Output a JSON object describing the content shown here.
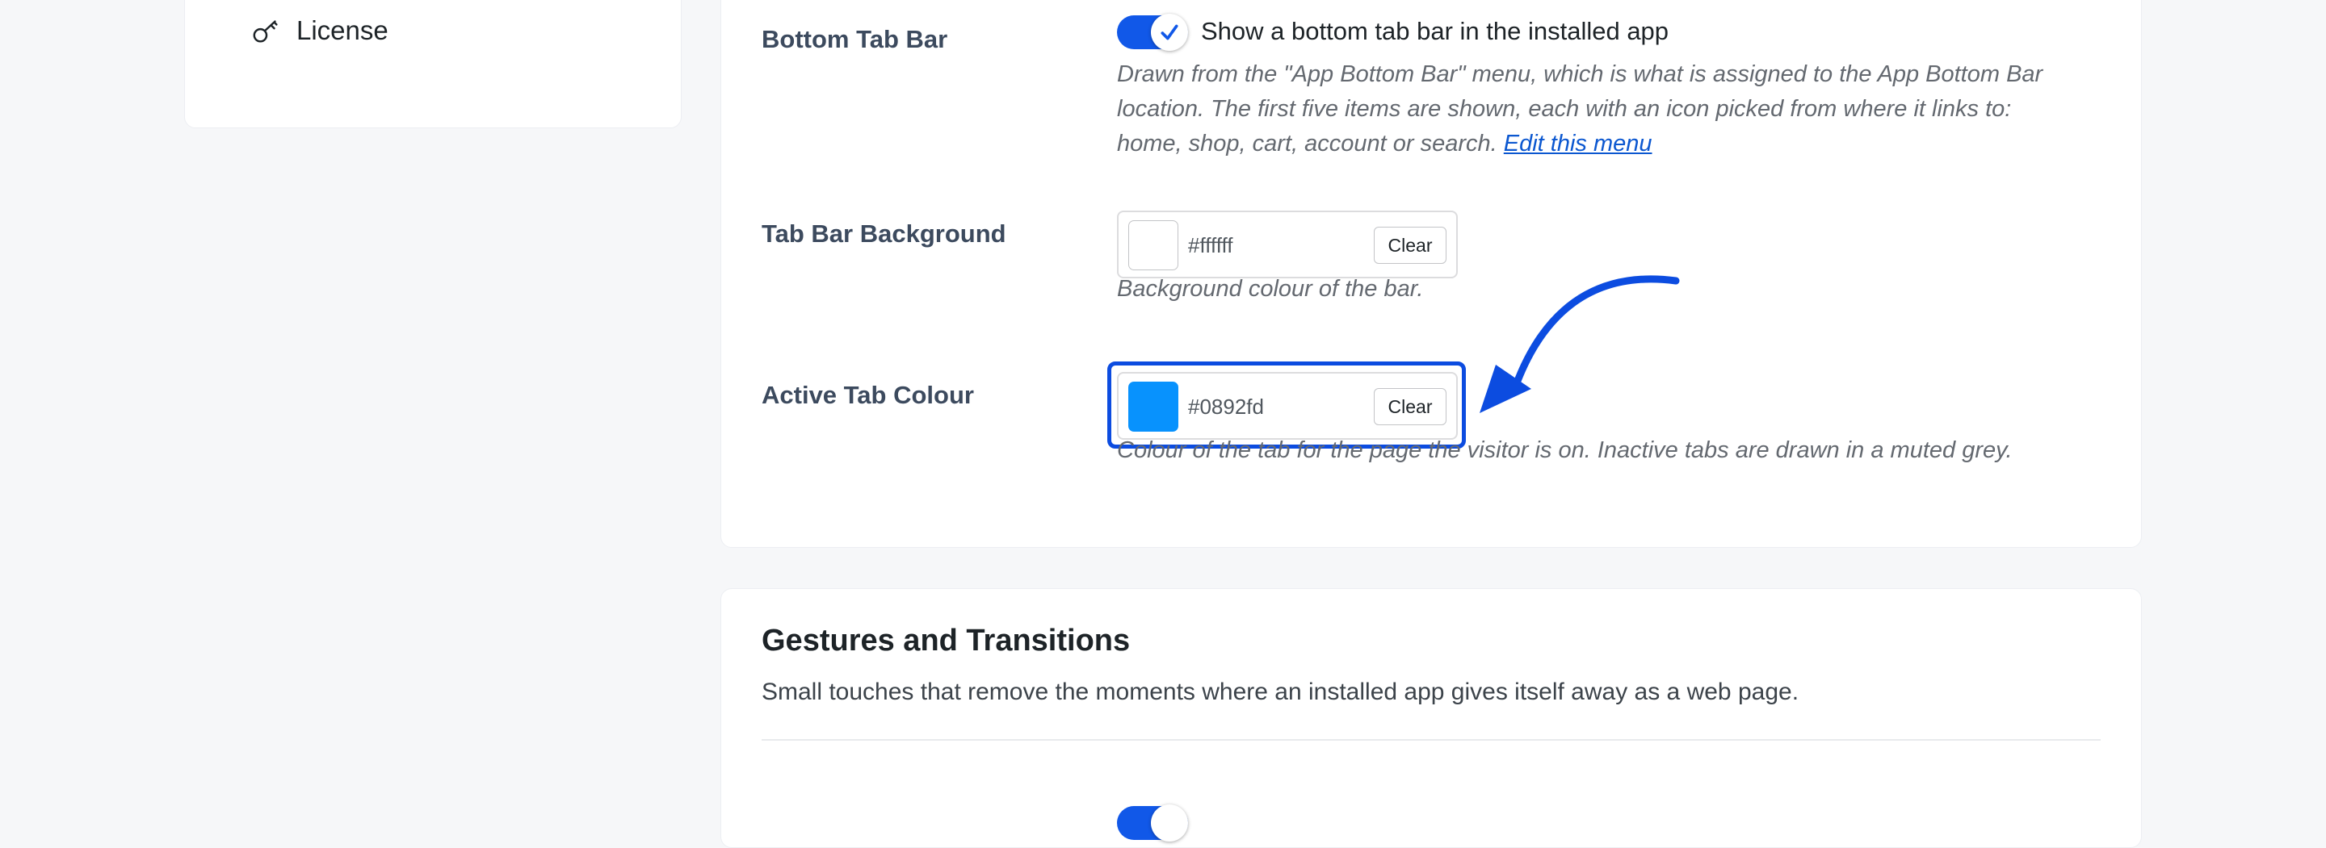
{
  "sidebar": {
    "license_label": "License",
    "license_icon": "key-icon"
  },
  "settings": {
    "bottom_tab_bar": {
      "label": "Bottom Tab Bar",
      "toggle_checked": true,
      "toggle_text": "Show a bottom tab bar in the installed app",
      "description_line1": "Drawn from the \"App Bottom Bar\" menu, which is what is assigned to the App Bottom Bar",
      "description_line2": "location. The first five items are shown, each with an icon picked from where it links to:",
      "description_line3": "home, shop, cart, account or search.",
      "edit_link": "Edit this menu"
    },
    "tab_bar_background": {
      "label": "Tab Bar Background",
      "value": "#ffffff",
      "swatch_color": "#ffffff",
      "clear_label": "Clear",
      "description": "Background colour of the bar."
    },
    "active_tab_colour": {
      "label": "Active Tab Colour",
      "value": "#0892fd",
      "swatch_color": "#0892fd",
      "clear_label": "Clear",
      "description": "Colour of the tab for the page the visitor is on. Inactive tabs are drawn in a muted grey."
    }
  },
  "gestures": {
    "title": "Gestures and Transitions",
    "description": "Small touches that remove the moments where an installed app gives itself away as a web page."
  },
  "colors": {
    "accent": "#1158e8",
    "annotation": "#0c4ce0",
    "link": "#0b57d0"
  }
}
